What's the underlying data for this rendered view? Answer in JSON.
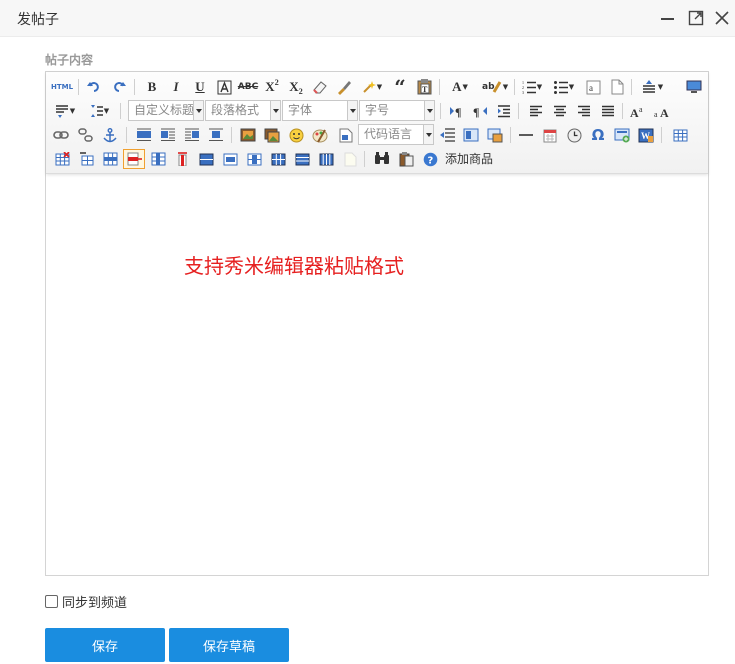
{
  "dialog": {
    "title": "发帖子"
  },
  "section": {
    "label": "帖子内容"
  },
  "toolbar": {
    "html_label": "HTML",
    "heading_combo": "自定义标题",
    "paragraph_combo": "段落格式",
    "font_combo": "字体",
    "size_combo": "字号",
    "code_lang_combo": "代码语言",
    "add_product": "添加商品",
    "bold": "B",
    "italic": "I",
    "underline": "U",
    "font_color": "A"
  },
  "editor": {
    "content": "支持秀米编辑器粘贴格式"
  },
  "sync": {
    "label": "同步到频道",
    "checked": false
  },
  "buttons": {
    "save": "保存",
    "save_draft": "保存草稿"
  },
  "colors": {
    "primary": "#1a8de0",
    "content_text": "#e62020",
    "toolbar_bg": "#f1f1f1",
    "icon_blue": "#3a6fc0"
  }
}
